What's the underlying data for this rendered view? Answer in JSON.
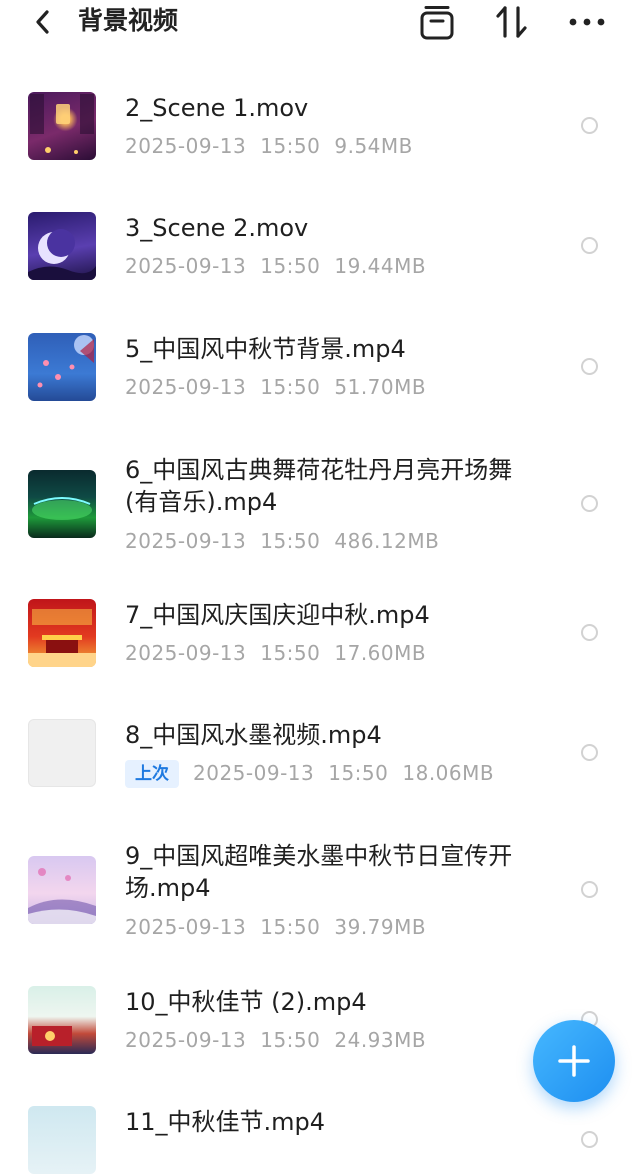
{
  "header": {
    "title": "背景视频"
  },
  "files": [
    {
      "name": "2_Scene 1.mov",
      "date": "2025-09-13",
      "time": "15:50",
      "size": "9.54MB"
    },
    {
      "name": "3_Scene 2.mov",
      "date": "2025-09-13",
      "time": "15:50",
      "size": "19.44MB"
    },
    {
      "name": "5_中国风中秋节背景.mp4",
      "date": "2025-09-13",
      "time": "15:50",
      "size": "51.70MB"
    },
    {
      "name": "6_中国风古典舞荷花牡丹月亮开场舞(有音乐).mp4",
      "date": "2025-09-13",
      "time": "15:50",
      "size": "486.12MB"
    },
    {
      "name": "7_中国风庆国庆迎中秋.mp4",
      "date": "2025-09-13",
      "time": "15:50",
      "size": "17.60MB"
    },
    {
      "name": "8_中国风水墨视频.mp4",
      "badge": "上次",
      "date": "2025-09-13",
      "time": "15:50",
      "size": "18.06MB"
    },
    {
      "name": "9_中国风超唯美水墨中秋节日宣传开场.mp4",
      "date": "2025-09-13",
      "time": "15:50",
      "size": "39.79MB"
    },
    {
      "name": "10_中秋佳节 (2).mp4",
      "date": "2025-09-13",
      "time": "15:50",
      "size": "24.93MB"
    },
    {
      "name": "11_中秋佳节.mp4"
    }
  ],
  "colors": {
    "accent": "#1d8ef0",
    "badge_bg": "#e6f1ff",
    "meta_text": "#a6a6a6"
  }
}
